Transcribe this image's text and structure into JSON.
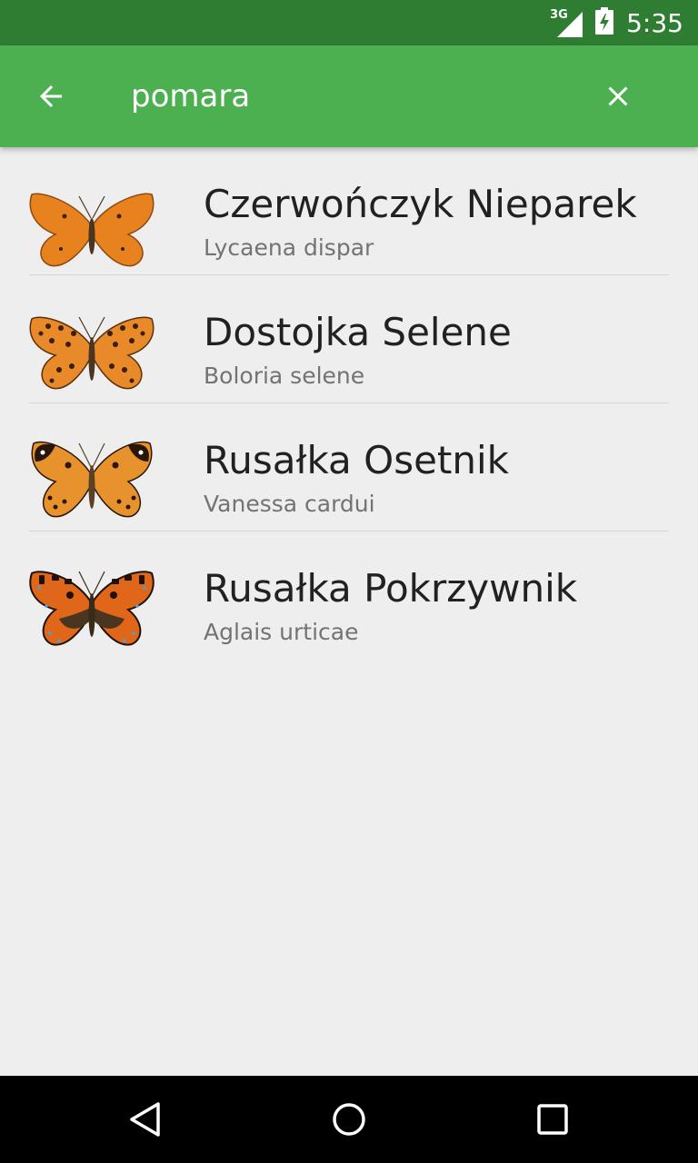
{
  "status_bar": {
    "network": "3G",
    "time": "5:35",
    "icons": [
      "signal-icon",
      "battery-charging-icon"
    ]
  },
  "app_bar": {
    "back_icon": "arrow-back-icon",
    "search_value": "pomara",
    "clear_icon": "close-icon",
    "accent": "#4caf50",
    "status_bar_color": "#2e7d32"
  },
  "results": [
    {
      "name": "Czerwończyk Nieparek",
      "latin": "Lycaena dispar",
      "icon": "butterfly-orange-icon"
    },
    {
      "name": "Dostojka Selene",
      "latin": "Boloria selene",
      "icon": "butterfly-spotted-icon"
    },
    {
      "name": "Rusałka Osetnik",
      "latin": "Vanessa cardui",
      "icon": "butterfly-painted-lady-icon"
    },
    {
      "name": "Rusałka Pokrzywnik",
      "latin": "Aglais urticae",
      "icon": "butterfly-tortoiseshell-icon"
    }
  ],
  "nav_bar": {
    "icons": [
      "back-triangle-icon",
      "home-circle-icon",
      "recents-square-icon"
    ]
  }
}
